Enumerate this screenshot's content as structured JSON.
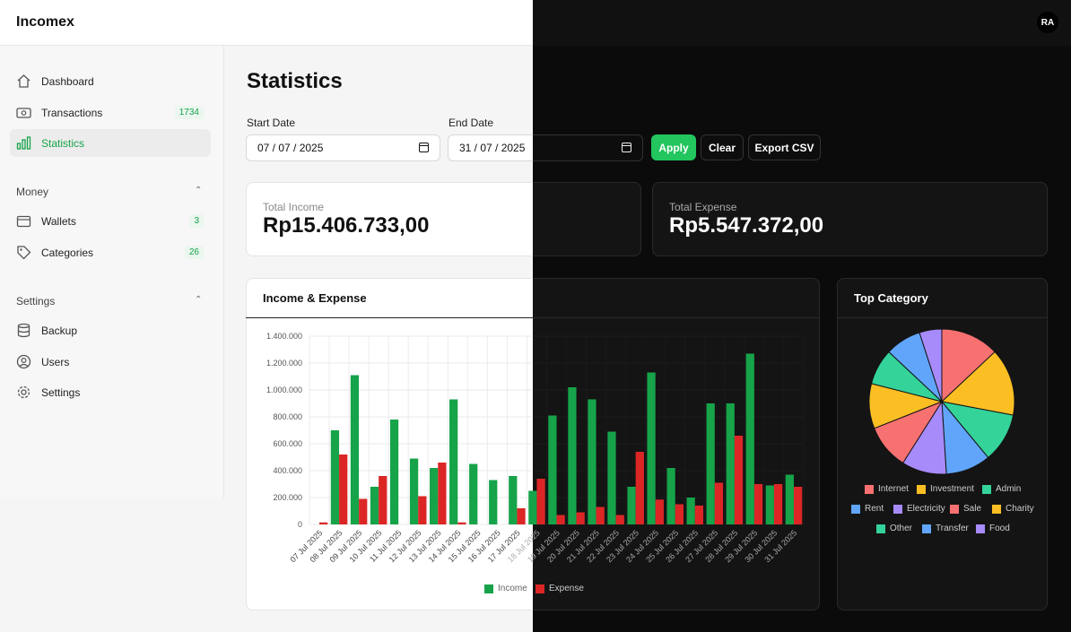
{
  "app": {
    "name": "Incomex",
    "avatar_initials": "RA"
  },
  "sidebar": {
    "items": [
      {
        "label": "Dashboard",
        "icon": "home-icon",
        "badge": null,
        "active": false
      },
      {
        "label": "Transactions",
        "icon": "cash-icon",
        "badge": "1734",
        "active": false
      },
      {
        "label": "Statistics",
        "icon": "chart-bars-icon",
        "badge": null,
        "active": true
      }
    ],
    "money_group": {
      "label": "Money",
      "items": [
        {
          "label": "Wallets",
          "icon": "wallet-icon",
          "badge": "3"
        },
        {
          "label": "Categories",
          "icon": "tag-icon",
          "badge": "26"
        }
      ]
    },
    "settings_group": {
      "label": "Settings",
      "items": [
        {
          "label": "Backup",
          "icon": "database-icon"
        },
        {
          "label": "Users",
          "icon": "user-circle-icon"
        },
        {
          "label": "Settings",
          "icon": "gear-icon"
        }
      ]
    }
  },
  "main": {
    "title": "Statistics",
    "start_date_label": "Start Date",
    "start_date_value": "07 / 07 / 2025",
    "end_date_label": "End Date",
    "end_date_value": "31 / 07 / 2025",
    "apply_label": "Apply",
    "clear_label": "Clear",
    "export_label": "Export CSV",
    "total_income_label": "Total Income",
    "total_income_value": "Rp15.406.733,00",
    "total_expense_label": "Total Expense",
    "total_expense_value": "Rp5.547.372,00"
  },
  "colors": {
    "income": "#16a34a",
    "expense": "#dc2626",
    "accent": "#22c55e"
  },
  "chart_data": [
    {
      "type": "bar",
      "title": "Income & Expense",
      "categories": [
        "07 Jul 2025",
        "08 Jul 2025",
        "09 Jul 2025",
        "10 Jul 2025",
        "11 Jul 2025",
        "12 Jul 2025",
        "13 Jul 2025",
        "14 Jul 2025",
        "15 Jul 2025",
        "16 Jul 2025",
        "17 Jul 2025",
        "18 Jul 2025",
        "19 Jul 2025",
        "20 Jul 2025",
        "21 Jul 2025",
        "22 Jul 2025",
        "23 Jul 2025",
        "24 Jul 2025",
        "25 Jul 2025",
        "26 Jul 2025",
        "27 Jul 2025",
        "28 Jul 2025",
        "29 Jul 2025",
        "30 Jul 2025",
        "31 Jul 2025"
      ],
      "series": [
        {
          "name": "Income",
          "values": [
            0,
            700000,
            1110000,
            280000,
            780000,
            490000,
            420000,
            930000,
            450000,
            330000,
            360000,
            250000,
            810000,
            1020000,
            930000,
            690000,
            280000,
            1130000,
            420000,
            200000,
            900000,
            900000,
            1270000,
            290000,
            370000
          ]
        },
        {
          "name": "Expense",
          "values": [
            15000,
            520000,
            190000,
            360000,
            0,
            210000,
            460000,
            15000,
            0,
            0,
            120000,
            340000,
            70000,
            90000,
            130000,
            70000,
            540000,
            185000,
            150000,
            140000,
            310000,
            660000,
            300000,
            300000,
            280000
          ]
        }
      ],
      "y_ticks": [
        "0",
        "200.000",
        "400.000",
        "600.000",
        "800.000",
        "1.000.000",
        "1.200.000",
        "1.400.000"
      ],
      "ylim": [
        0,
        1400000
      ],
      "grid": true,
      "legend_position": "bottom"
    },
    {
      "type": "pie",
      "title": "Top Category",
      "labels": [
        "Internet",
        "Investment",
        "Admin",
        "Rent",
        "Electricity",
        "Sale",
        "Charity",
        "Other",
        "Transfer",
        "Food"
      ],
      "values": [
        13,
        15,
        11,
        10,
        10,
        10,
        10,
        8,
        8,
        5
      ],
      "colors": [
        "#f87171",
        "#fbbf24",
        "#34d399",
        "#60a5fa",
        "#a78bfa",
        "#f87171",
        "#fbbf24",
        "#34d399",
        "#60a5fa",
        "#a78bfa"
      ],
      "legend_position": "bottom"
    }
  ]
}
